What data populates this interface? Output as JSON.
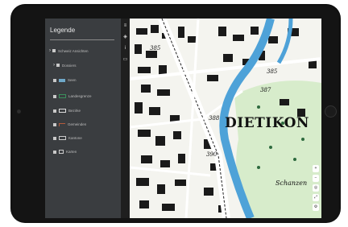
{
  "legend": {
    "title": "Legende",
    "items": [
      {
        "label": "Schweiz Ansichten",
        "type": "group"
      },
      {
        "label": "Dossiers",
        "type": "group"
      },
      {
        "label": "Seen",
        "color": "#6fa8c9"
      },
      {
        "label": "Landesgrenze",
        "color": "#3a8f5b"
      },
      {
        "label": "Bezirke",
        "color": "#d8d8d8"
      },
      {
        "label": "Gemeinden",
        "color": "#b45b3c"
      },
      {
        "label": "Kantone",
        "color": "#cfcfcf"
      },
      {
        "label": "Karten",
        "color": "#cfcfcf"
      }
    ]
  },
  "map": {
    "place_name": "DIETIKON",
    "district_name": "Schanzen",
    "elevations": [
      "385",
      "388",
      "390",
      "387",
      "385"
    ],
    "colors": {
      "river": "#4ea2d8",
      "forest": "#d7eccb",
      "road": "#ffffff"
    }
  },
  "toolbar_icons": [
    "menu-icon",
    "layers-icon",
    "info-icon",
    "print-icon"
  ],
  "map_controls": [
    "zoom-in-icon",
    "zoom-out-icon",
    "locate-icon",
    "fullscreen-icon",
    "settings-icon"
  ]
}
